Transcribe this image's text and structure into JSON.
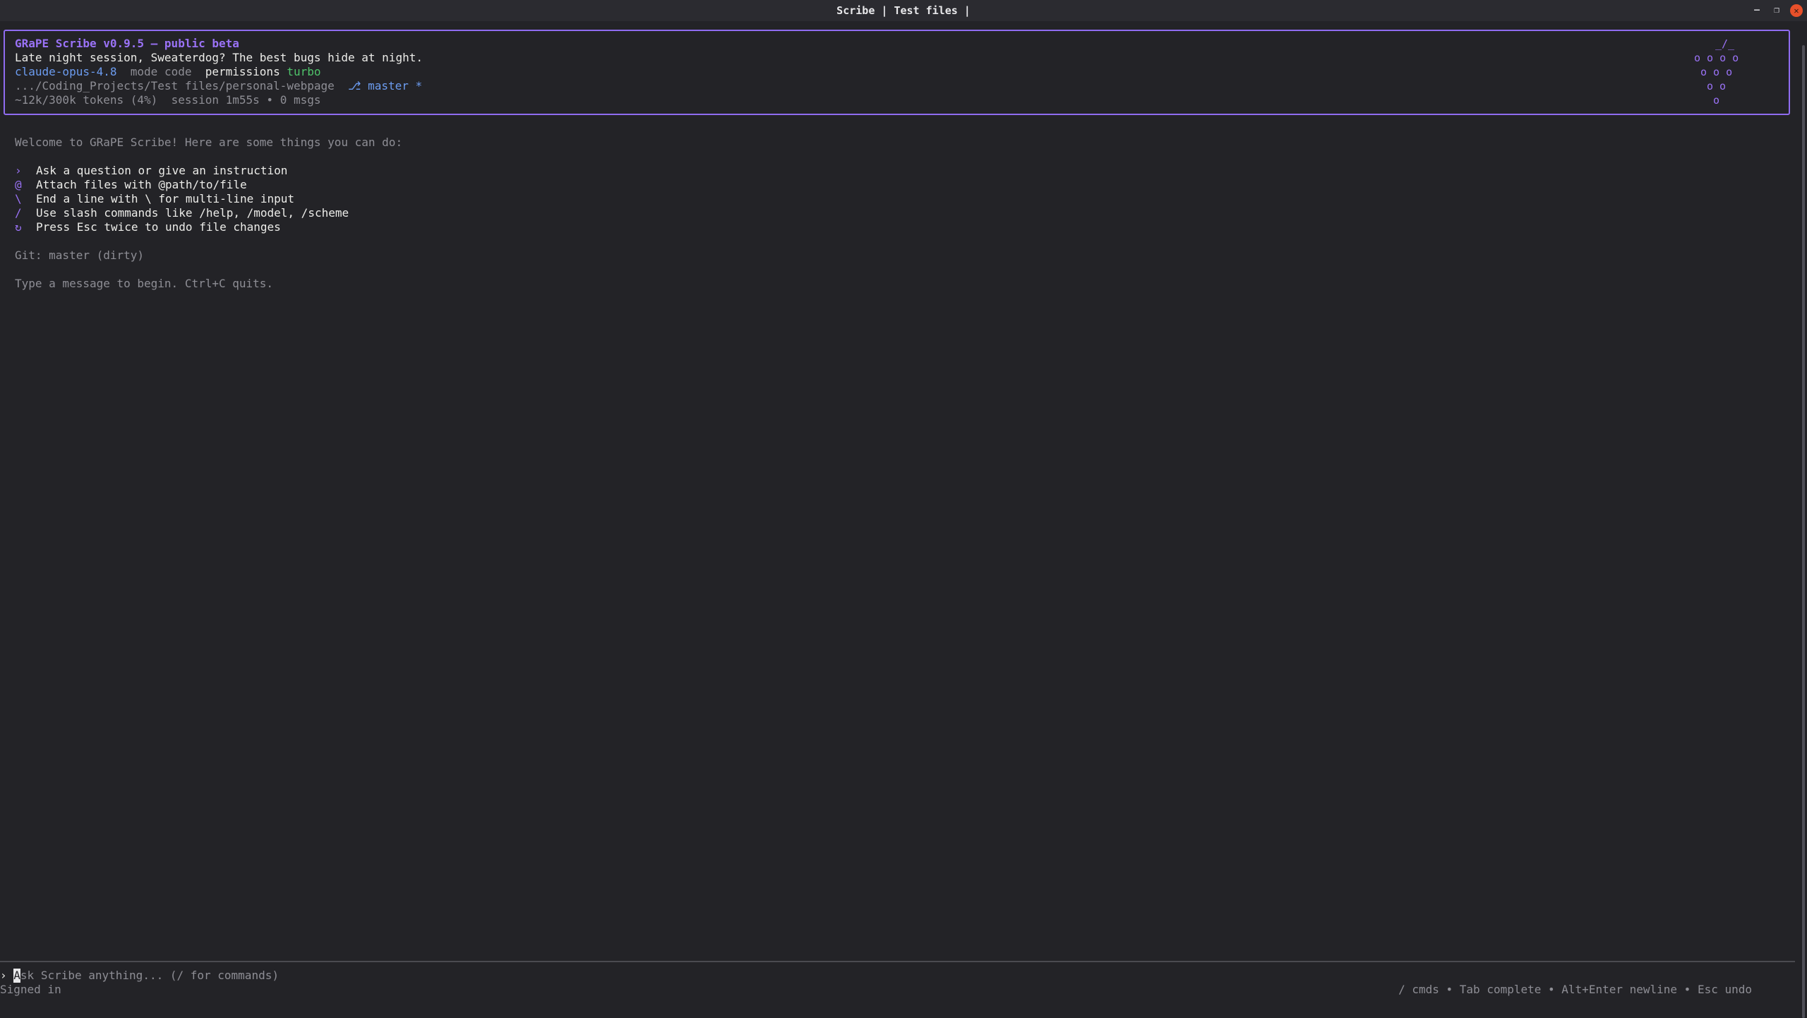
{
  "window": {
    "title": "Scribe | Test files |",
    "controls": [
      "minimize",
      "maximize",
      "close"
    ]
  },
  "header": {
    "app_title": "GRaPE Scribe v0.9.5 – public beta",
    "greeting": "Late night session, Sweaterdog? The best bugs hide at night.",
    "model": "claude-opus-4.8",
    "mode_label": "mode",
    "mode_value": "code",
    "permissions_label": "permissions",
    "permissions_value": "turbo",
    "path": ".../Coding_Projects/Test files/personal-webpage",
    "branch": "master",
    "branch_dirty_marker": "*",
    "tokens": "~12k/300k tokens (4%)",
    "session": "session 1m55s • 0 msgs",
    "logo_lines": [
      "_/_",
      "o o o o",
      "o o o",
      "o o",
      "o"
    ]
  },
  "welcome": {
    "intro": "Welcome to GRaPE Scribe! Here are some things you can do:",
    "tips": [
      {
        "symbol": "›",
        "text": "Ask a question or give an instruction"
      },
      {
        "symbol": "@",
        "text": "Attach files with @path/to/file"
      },
      {
        "symbol": "\\",
        "text": "End a line with \\ for multi-line input"
      },
      {
        "symbol": "/",
        "text": "Use slash commands like /help, /model, /scheme"
      },
      {
        "symbol": "↻",
        "text": "Press Esc twice to undo file changes"
      }
    ],
    "git_status": "Git: master (dirty)",
    "hint": "Type a message to begin. Ctrl+C quits."
  },
  "input": {
    "prompt_symbol": "›",
    "placeholder_first_char": "A",
    "placeholder_rest": "sk Scribe anything... (/ for commands)"
  },
  "status": {
    "left": "Signed in",
    "right": "/ cmds • Tab complete • Alt+Enter newline • Esc undo"
  },
  "colors": {
    "accent_purple": "#9a72f6",
    "model_blue": "#6c9cf0",
    "turbo_green": "#4fc36a",
    "background": "#232327"
  }
}
